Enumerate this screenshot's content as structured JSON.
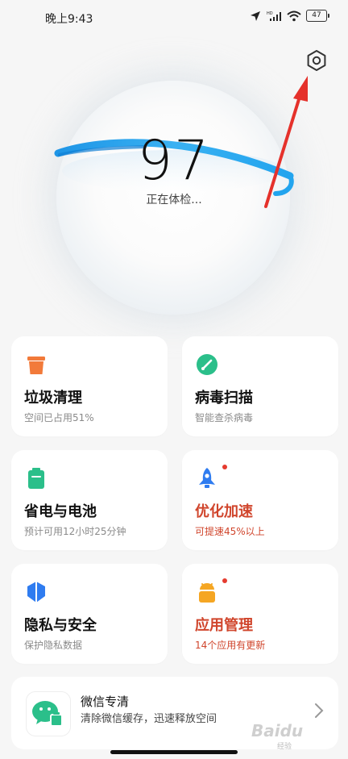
{
  "status_bar": {
    "time": "晚上9:43",
    "battery": "47",
    "network": "HD",
    "icons": [
      "location-icon",
      "signal-icon",
      "wifi-icon",
      "battery-icon"
    ]
  },
  "header": {
    "settings_icon": "gear-icon"
  },
  "score": {
    "value": "97",
    "status": "正在体检..."
  },
  "cards": [
    {
      "title": "垃圾清理",
      "desc": "空间已占用51%",
      "icon": "trash-icon",
      "icon_color": "#f27a3a",
      "badge": false
    },
    {
      "title": "病毒扫描",
      "desc": "智能查杀病毒",
      "icon": "virus-scan-icon",
      "icon_color": "#2bbf8a",
      "badge": false
    },
    {
      "title": "省电与电池",
      "desc": "预计可用12小时25分钟",
      "icon": "battery-icon",
      "icon_color": "#2bbf8a",
      "badge": false
    },
    {
      "title": "优化加速",
      "desc": "可提速45%以上",
      "icon": "rocket-icon",
      "icon_color": "#2f7cf0",
      "badge": true
    },
    {
      "title": "隐私与安全",
      "desc": "保护隐私数据",
      "icon": "shield-icon",
      "icon_color": "#2f7cf0",
      "badge": false
    },
    {
      "title": "应用管理",
      "desc": "14个应用有更新",
      "icon": "android-icon",
      "icon_color": "#f5a623",
      "badge": true
    }
  ],
  "wechat_clean": {
    "title": "微信专清",
    "desc": "清除微信缓存，迅速释放空间",
    "icon": "wechat-clean-icon"
  },
  "colors": {
    "accent_green": "#2bbf8a",
    "warn_red": "#d0452c",
    "orb_blue": "#22a4ee"
  },
  "watermark": {
    "text": "Baidu",
    "sub": "经验"
  }
}
